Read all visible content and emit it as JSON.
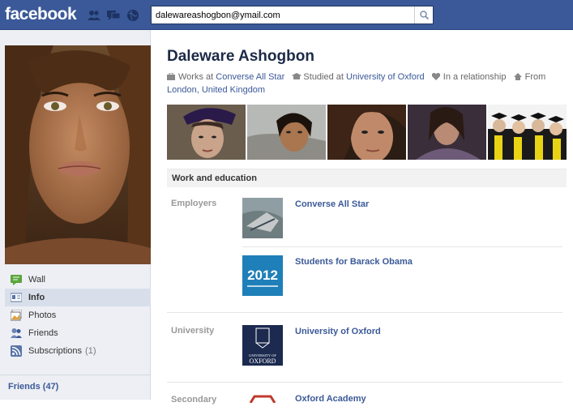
{
  "header": {
    "logo": "facebook",
    "search_value": "dalewareashogbon@ymail.com",
    "jewel_icons": [
      "friend-requests-icon",
      "messages-icon",
      "notifications-icon"
    ],
    "brand_color": "#3b5998"
  },
  "sidebar": {
    "items": [
      {
        "label": "Wall",
        "icon": "wall-icon",
        "active": false,
        "count": ""
      },
      {
        "label": "Info",
        "icon": "info-icon",
        "active": true,
        "count": ""
      },
      {
        "label": "Photos",
        "icon": "photos-icon",
        "active": false,
        "count": ""
      },
      {
        "label": "Friends",
        "icon": "friends-icon",
        "active": false,
        "count": ""
      },
      {
        "label": "Subscriptions",
        "icon": "subscriptions-icon",
        "active": false,
        "count": "(1)"
      }
    ],
    "friends_link": "Friends (47)"
  },
  "profile": {
    "name": "Daleware Ashogbon",
    "works_prefix": "Works at",
    "works_at": "Converse All Star",
    "studied_prefix": "Studied at",
    "studied_at": "University of Oxford",
    "relationship": "In a relationship",
    "from_prefix": "From",
    "from": "London, United Kingdom"
  },
  "work_education": {
    "heading": "Work and education",
    "employers_label": "Employers",
    "employers": [
      "Converse All Star",
      "Students for Barack Obama"
    ],
    "university_label": "University",
    "university": "University of Oxford",
    "university_logo_text": "UNIVERSITY OF OXFORD",
    "obama_logo_text": "2012",
    "secondary_label": "Secondary",
    "secondary": "Oxford Academy"
  }
}
